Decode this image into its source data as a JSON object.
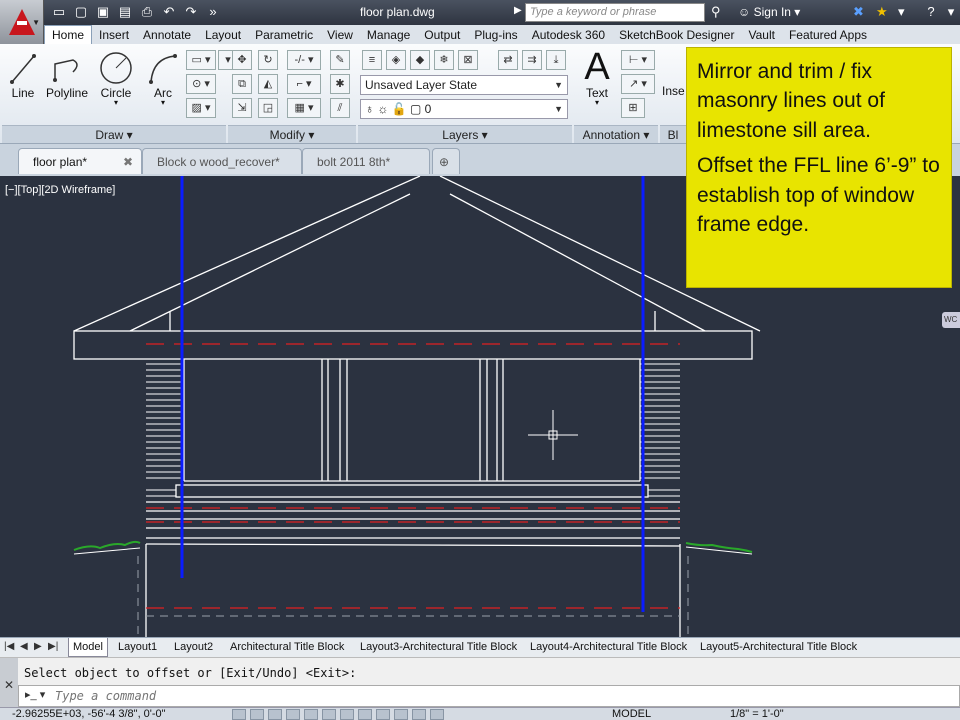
{
  "titlebar": {
    "file_name": "floor plan.dwg",
    "search_placeholder": "Type a keyword or phrase",
    "sign_in": "Sign In"
  },
  "ribbon_tabs": [
    "Home",
    "Insert",
    "Annotate",
    "Layout",
    "Parametric",
    "View",
    "Manage",
    "Output",
    "Plug-ins",
    "Autodesk 360",
    "SketchBook Designer",
    "Vault",
    "Featured Apps"
  ],
  "draw_tools": {
    "line": "Line",
    "polyline": "Polyline",
    "circle": "Circle",
    "arc": "Arc"
  },
  "panels": {
    "draw": "Draw",
    "modify": "Modify",
    "layers": "Layers",
    "annotation": "Annotation",
    "block_partial": "Bl"
  },
  "layers": {
    "state": "Unsaved Layer State",
    "current": "0"
  },
  "annotation_tools": {
    "text": "Text",
    "insert_partial": "Inse"
  },
  "document_tabs": [
    {
      "label": "floor plan*"
    },
    {
      "label": "Block o wood_recover*"
    },
    {
      "label": "bolt 2011 8th*"
    }
  ],
  "viewport_label": "[−][Top][2D Wireframe]",
  "nav_chip": "WC",
  "note": {
    "line1": "Mirror and trim / fix masonry lines out of limestone sill area.",
    "line2": "Offset the FFL line 6’-9” to establish top of window frame edge."
  },
  "layout_tabs": [
    "Model",
    "Layout1",
    "Layout2",
    "Architectural Title Block",
    "Layout3-Architectural Title Block",
    "Layout4-Architectural Title Block",
    "Layout5-Architectural Title Block"
  ],
  "command": {
    "history": "Select object to offset or [Exit/Undo] <Exit>:",
    "placeholder": "Type a command"
  },
  "status": {
    "coords": "-2.96255E+03, -56'-4 3/8\", 0'-0\"",
    "space": "MODEL",
    "scale": "1/8\" = 1'-0\""
  },
  "colors": {
    "canvas": "#2b3240",
    "note": "#e8e400",
    "guide_blue": "#0a1cff",
    "dash_red": "#e02020",
    "grass": "#2aa82a"
  }
}
